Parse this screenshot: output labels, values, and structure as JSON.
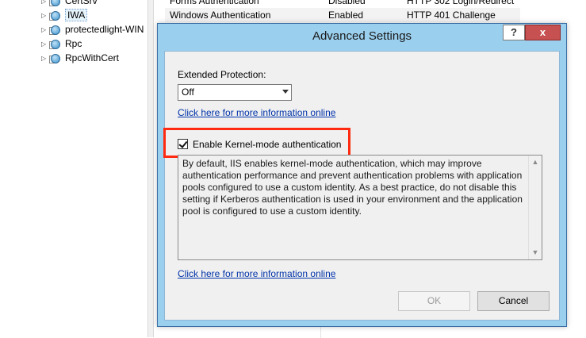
{
  "tree": {
    "items": [
      {
        "label": "CertSrv"
      },
      {
        "label": "IWA"
      },
      {
        "label": "protectedlight-WIN"
      },
      {
        "label": "Rpc"
      },
      {
        "label": "RpcWithCert"
      }
    ]
  },
  "auth_grid": {
    "rows": [
      {
        "name": "Forms Authentication",
        "status": "Disabled",
        "type": "HTTP 302 Login/Redirect"
      },
      {
        "name": "Windows Authentication",
        "status": "Enabled",
        "type": "HTTP 401 Challenge"
      }
    ]
  },
  "dialog": {
    "title": "Advanced Settings",
    "help_label": "?",
    "close_label": "x",
    "extended_protection_label": "Extended Protection:",
    "extended_protection_value": "Off",
    "info_link_1": "Click here for more information online",
    "kernel_mode_label": "Enable Kernel-mode authentication",
    "kernel_mode_checked": true,
    "description": "By default, IIS enables kernel-mode authentication, which may improve authentication performance and prevent authentication problems with application pools configured to use a custom identity. As a best practice, do not disable this setting if Kerberos authentication is used in your environment and the application pool is configured to use a custom identity.",
    "info_link_2": "Click here for more information online",
    "ok_label": "OK",
    "cancel_label": "Cancel"
  },
  "colors": {
    "dialog_frame": "#9bcfee",
    "close_button": "#c75050",
    "highlight_box": "#ff2a10",
    "link": "#0033aa"
  }
}
